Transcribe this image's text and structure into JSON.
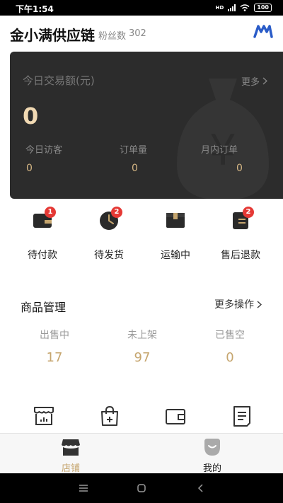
{
  "status_bar": {
    "time": "下午1:54",
    "network": "HD",
    "battery": "100"
  },
  "header": {
    "shop_name": "金小满供应链",
    "fans_label": "粉丝数",
    "fans_count": "302",
    "logo_icon": "m-logo-icon"
  },
  "dashboard": {
    "title": "今日交易额(元)",
    "more_label": "更多",
    "amount": "0",
    "stats": [
      {
        "label": "今日访客",
        "value": "0"
      },
      {
        "label": "订单量",
        "value": "0"
      },
      {
        "label": "月内订单",
        "value": "0"
      }
    ],
    "colors": {
      "card_bg": "#2c2c2c",
      "amount": "#f1d9b3",
      "stat_value": "#d6b785"
    }
  },
  "orders": [
    {
      "label": "待付款",
      "badge": "1",
      "icon": "wallet-icon"
    },
    {
      "label": "待发货",
      "badge": "2",
      "icon": "clock-icon"
    },
    {
      "label": "运输中",
      "badge": "",
      "icon": "package-icon"
    },
    {
      "label": "售后退款",
      "badge": "2",
      "icon": "refund-icon"
    }
  ],
  "products": {
    "title": "商品管理",
    "more_ops_label": "更多操作",
    "stats": [
      {
        "label": "出售中",
        "value": "17"
      },
      {
        "label": "未上架",
        "value": "97"
      },
      {
        "label": "已售空",
        "value": "0"
      }
    ],
    "value_color": "#c6a66f"
  },
  "tools": [
    "store-stats-icon",
    "shopping-bag-add-icon",
    "wallet-icon",
    "document-icon"
  ],
  "tabs": [
    {
      "label": "店铺",
      "icon": "store-icon",
      "active": true
    },
    {
      "label": "我的",
      "icon": "profile-icon",
      "active": false
    }
  ],
  "accent_color": "#c6a66f"
}
